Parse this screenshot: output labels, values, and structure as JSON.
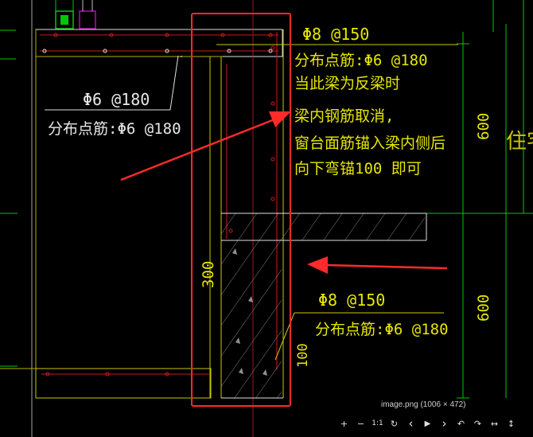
{
  "drawing": {
    "top_bar_label": "Φ8 @150",
    "top_dist_label": "分布点筋:Φ6 @180",
    "note_lines": [
      "当此梁为反梁时",
      "梁内钢筋取消,",
      "窗台面筋锚入梁内侧后",
      "向下弯锚100 即可"
    ],
    "left_bar_label": "Φ6 @180",
    "left_dist_label": "分布点筋:Φ6 @180",
    "lower_bar_label": "Φ8 @150",
    "lower_dist_label": "分布点筋:Φ6 @180",
    "dim_300": "300",
    "dim_100": "100",
    "dim_600_top": "600",
    "dim_600_bottom": "600",
    "side_text": "住宅",
    "colors": {
      "background": "#000000",
      "annotation": "#e6e600",
      "highlight_box": "#ff2a2a",
      "arrow": "#ff2a2a",
      "grid_green": "#00c800",
      "rebar_red": "#d01818",
      "outline_white": "#e0e0e0"
    }
  },
  "viewer": {
    "caption": "image.png (1006 × 472)",
    "toolbar": [
      {
        "name": "zoom-in-icon",
        "glyph": "+"
      },
      {
        "name": "zoom-out-icon",
        "glyph": "−"
      },
      {
        "name": "actual-size-icon",
        "glyph": "1:1"
      },
      {
        "name": "rotate-reset-icon",
        "glyph": "↻"
      },
      {
        "name": "previous-icon",
        "glyph": "‹"
      },
      {
        "name": "play-icon",
        "glyph": "▶"
      },
      {
        "name": "next-icon",
        "glyph": "›"
      },
      {
        "name": "rotate-left-icon",
        "glyph": "↶"
      },
      {
        "name": "rotate-right-icon",
        "glyph": "↷"
      },
      {
        "name": "flip-horizontal-icon",
        "glyph": "↔"
      },
      {
        "name": "flip-vertical-icon",
        "glyph": "↕"
      }
    ]
  }
}
